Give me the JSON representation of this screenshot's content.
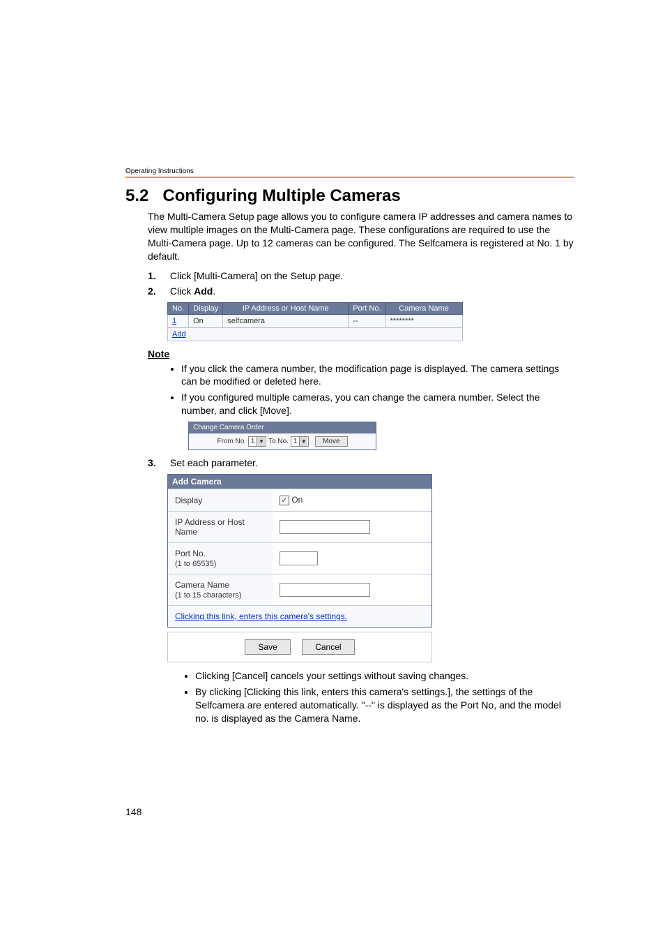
{
  "running_header": "Operating Instructions",
  "section_number": "5.2",
  "section_title": "Configuring Multiple Cameras",
  "intro": "The Multi-Camera Setup page allows you to configure camera IP addresses and camera names to view multiple images on the Multi-Camera page. These configurations are required to use the Multi-Camera page. Up to 12 cameras can be configured. The Selfcamera is registered at No. 1 by default.",
  "steps": [
    {
      "num": "1.",
      "text": "Click [Multi-Camera] on the Setup page."
    },
    {
      "num": "2.",
      "text_prefix": "Click ",
      "bold": "Add",
      "text_suffix": "."
    },
    {
      "num": "3.",
      "text": "Set each parameter."
    }
  ],
  "camera_table": {
    "headers": [
      "No.",
      "Display",
      "IP Address or Host Name",
      "Port No.",
      "Camera Name"
    ],
    "rows": [
      {
        "no": "1",
        "display": "On",
        "ip": "selfcamera",
        "port": "--",
        "name": "********"
      },
      {
        "no": "Add",
        "display": "",
        "ip": "",
        "port": "",
        "name": ""
      }
    ]
  },
  "note_heading": "Note",
  "note_bullets": [
    "If you click the camera number, the modification page is displayed. The camera settings can be modified or deleted here.",
    "If you configured multiple cameras, you can change the camera number. Select the number, and click [Move]."
  ],
  "order_box": {
    "title": "Change Camera Order",
    "from_label": "From No.",
    "from_value": "1",
    "to_label": "To No.",
    "to_value": "1",
    "move_button": "Move"
  },
  "add_camera": {
    "title": "Add Camera",
    "fields": {
      "display_label": "Display",
      "display_value": "On",
      "ip_label": "IP Address or Host Name",
      "ip_value": "",
      "port_label": "Port No.",
      "port_hint": "(1 to 65535)",
      "port_value": "",
      "name_label": "Camera Name",
      "name_hint": "(1 to 15 characters)",
      "name_value": ""
    },
    "link_text": "Clicking this link, enters this camera's settings.",
    "save_button": "Save",
    "cancel_button": "Cancel"
  },
  "post_bullets": [
    "Clicking [Cancel] cancels your settings without saving changes.",
    "By clicking [Clicking this link, enters this camera's settings.], the settings of the Selfcamera are entered automatically. \"--\" is displayed as the Port No, and the model no. is displayed as the Camera Name."
  ],
  "page_number": "148"
}
